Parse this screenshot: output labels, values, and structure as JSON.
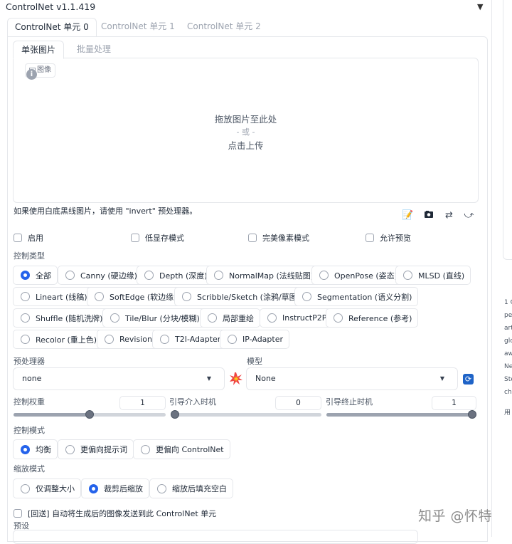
{
  "header": {
    "title": "ControlNet v1.1.419",
    "collapse_icon": "triangle-down-icon"
  },
  "unit_tabs": [
    "ControlNet 单元 0",
    "ControlNet 单元 1",
    "ControlNet 单元 2"
  ],
  "image_tabs": [
    "单张图片",
    "批量处理"
  ],
  "upload": {
    "image_label": "图像",
    "drop_text": "拖放图片至此处",
    "or_text": "- 或 -",
    "click_text": "点击上传"
  },
  "hint": "如果使用白底黑线图片，请使用 \"invert\" 预处理器。",
  "tool_icons": [
    "notepad-icon",
    "camera-icon",
    "swap-icon",
    "send-arrow-icon"
  ],
  "checkboxes": [
    "启用",
    "低显存模式",
    "完美像素模式",
    "允许预览"
  ],
  "control_type": {
    "label": "控制类型",
    "selected": "全部",
    "options": [
      "全部",
      "Canny (硬边缘)",
      "Depth (深度)",
      "NormalMap (法线贴图)",
      "OpenPose (姿态)",
      "MLSD (直线)",
      "Lineart (线稿)",
      "SoftEdge (软边缘)",
      "Scribble/Sketch (涂鸦/草图)",
      "Segmentation (语义分割)",
      "Shuffle (随机洗牌)",
      "Tile/Blur (分块/模糊)",
      "局部重绘",
      "InstructP2P",
      "Reference (参考)",
      "Recolor (重上色)",
      "Revision",
      "T2I-Adapter",
      "IP-Adapter"
    ]
  },
  "preprocessor": {
    "label": "预处理器",
    "value": "none",
    "run_icon": "explosion-icon"
  },
  "model": {
    "label": "模型",
    "value": "None",
    "refresh_icon": "refresh-icon"
  },
  "sliders": [
    {
      "label": "控制权重",
      "value": "1",
      "fraction": 0.5
    },
    {
      "label": "引导介入时机",
      "value": "0",
      "fraction": 0.0
    },
    {
      "label": "引导终止时机",
      "value": "1",
      "fraction": 1.0
    }
  ],
  "control_mode": {
    "label": "控制模式",
    "selected": "均衡",
    "options": [
      "均衡",
      "更偏向提示词",
      "更偏向 ControlNet"
    ]
  },
  "resize_mode": {
    "label": "缩放模式",
    "selected": "裁剪后缩放",
    "options": [
      "仅调整大小",
      "裁剪后缩放",
      "缩放后填充空白"
    ]
  },
  "loopback": {
    "label": "[回送] 自动将生成后的图像发送到此 ControlNet 单元"
  },
  "preset": {
    "label": "预设"
  },
  "sidebar_lines": [
    "1 C",
    "pe",
    "art",
    "glo",
    "aw",
    "Ne",
    "Ste",
    "ch",
    "用"
  ],
  "watermark": "知乎 @怀特"
}
